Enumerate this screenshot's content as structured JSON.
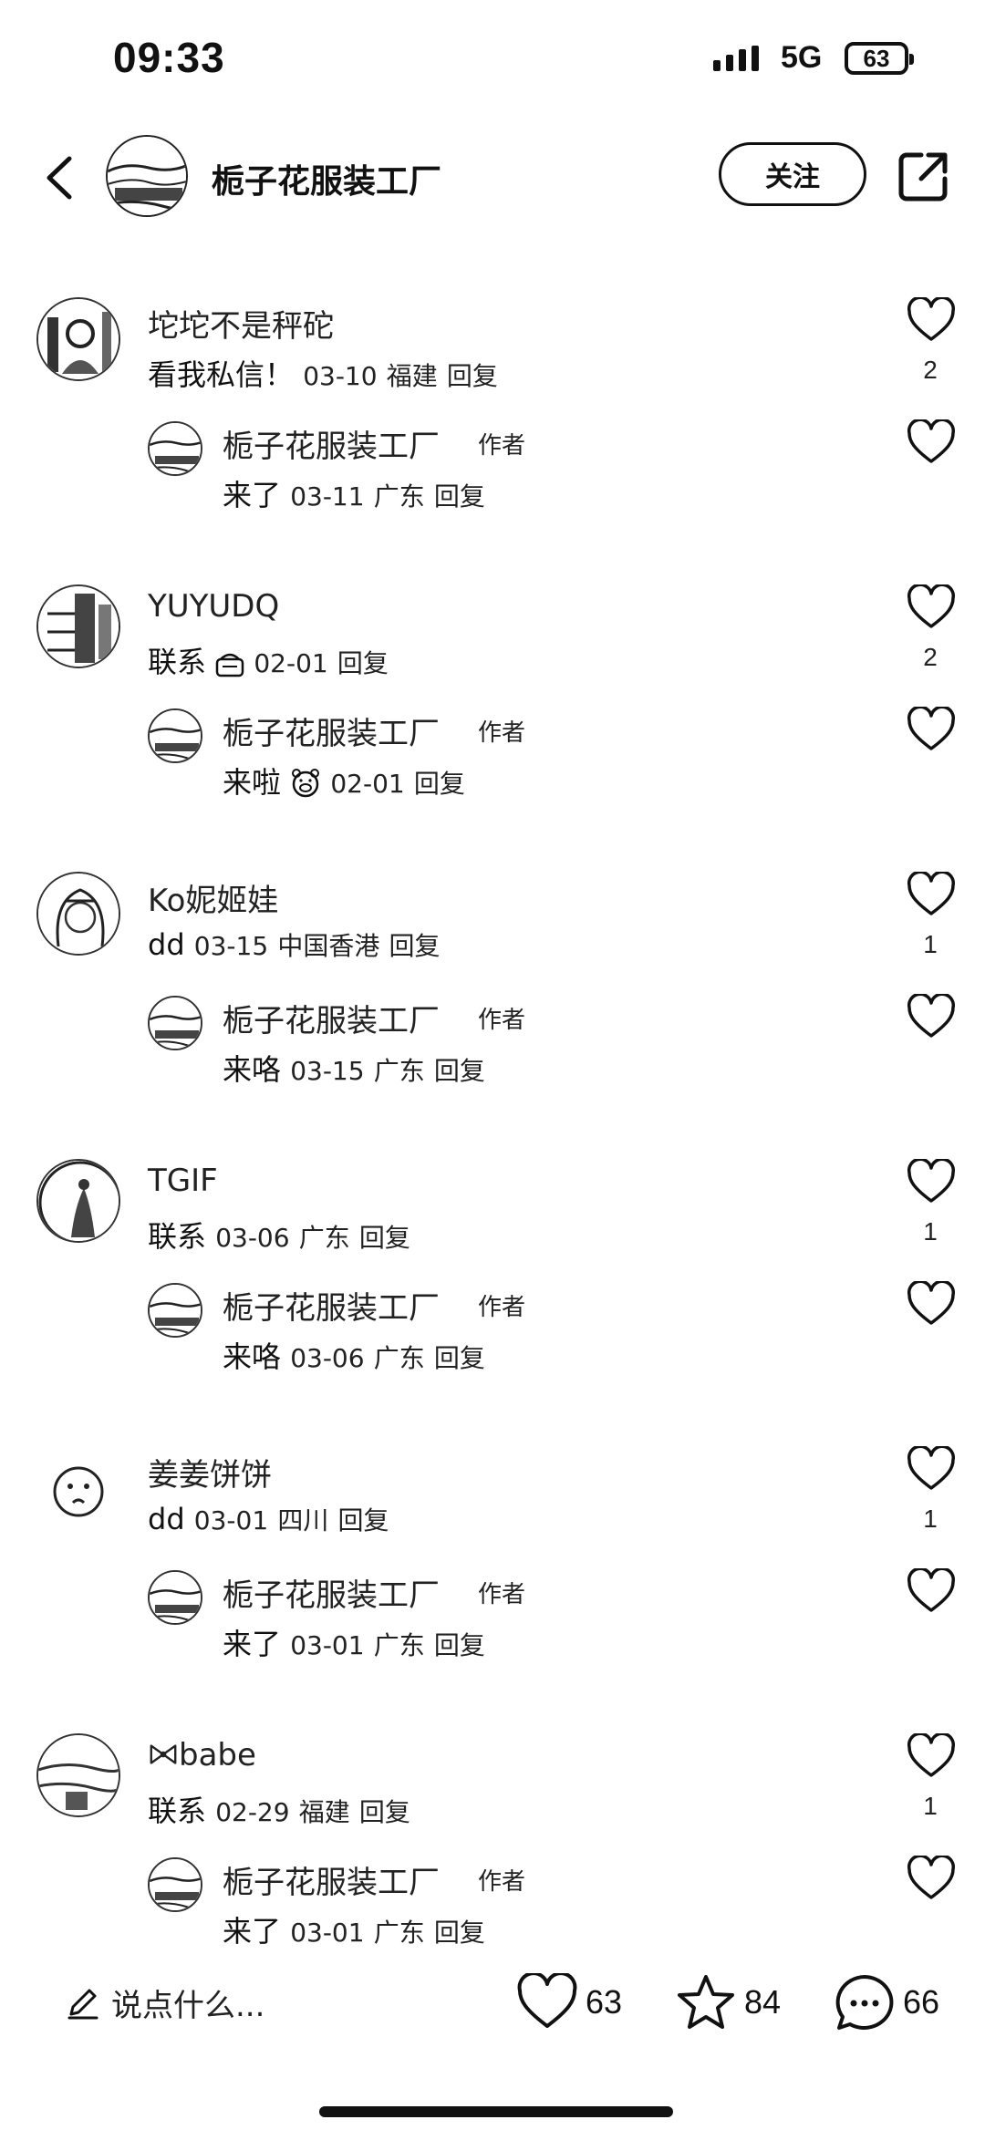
{
  "status": {
    "time": "09:33",
    "network": "5G",
    "battery": "63"
  },
  "header": {
    "title": "栀子花服装工厂",
    "follow_label": "关注",
    "avatar_icon": "factory-avatar-icon",
    "share_icon": "share-out-icon",
    "back_icon": "chevron-left-icon"
  },
  "comments": [
    {
      "user": "坨坨不是秤砣",
      "text": "看我私信！",
      "date": "03-10",
      "location": "福建",
      "reply_label": "回复",
      "likes": "2",
      "reply": {
        "user": "栀子花服装工厂",
        "badge": "作者",
        "text": "来了",
        "date": "03-11",
        "location": "广东",
        "reply_label": "回复"
      }
    },
    {
      "user": "YUYUDQ",
      "text": "联系",
      "emoji": "sticker-icon",
      "date": "02-01",
      "location": "",
      "reply_label": "回复",
      "likes": "2",
      "reply": {
        "user": "栀子花服装工厂",
        "badge": "作者",
        "text": "来啦",
        "emoji": "pig-face-emoji-icon",
        "date": "02-01",
        "location": "",
        "reply_label": "回复"
      }
    },
    {
      "user": "Ko妮姬娃",
      "text": "dd",
      "date": "03-15",
      "location": "中国香港",
      "reply_label": "回复",
      "likes": "1",
      "reply": {
        "user": "栀子花服装工厂",
        "badge": "作者",
        "text": "来咯",
        "date": "03-15",
        "location": "广东",
        "reply_label": "回复"
      }
    },
    {
      "user": "TGIF",
      "text": "联系",
      "date": "03-06",
      "location": "广东",
      "reply_label": "回复",
      "likes": "1",
      "reply": {
        "user": "栀子花服装工厂",
        "badge": "作者",
        "text": "来咯",
        "date": "03-06",
        "location": "广东",
        "reply_label": "回复"
      }
    },
    {
      "user": "姜姜饼饼",
      "text": "dd",
      "date": "03-01",
      "location": "四川",
      "reply_label": "回复",
      "likes": "1",
      "reply": {
        "user": "栀子花服装工厂",
        "badge": "作者",
        "text": "来了",
        "date": "03-01",
        "location": "广东",
        "reply_label": "回复"
      }
    },
    {
      "user": "babe",
      "user_prefix_icon": "bow-icon",
      "text": "联系",
      "date": "02-29",
      "location": "福建",
      "reply_label": "回复",
      "likes": "1",
      "reply": {
        "user": "栀子花服装工厂",
        "badge": "作者",
        "text": "来了",
        "date": "03-01",
        "location": "广东",
        "reply_label": "回复"
      }
    }
  ],
  "bottom": {
    "placeholder": "说点什么...",
    "likes": "63",
    "stars": "84",
    "comments": "66"
  }
}
